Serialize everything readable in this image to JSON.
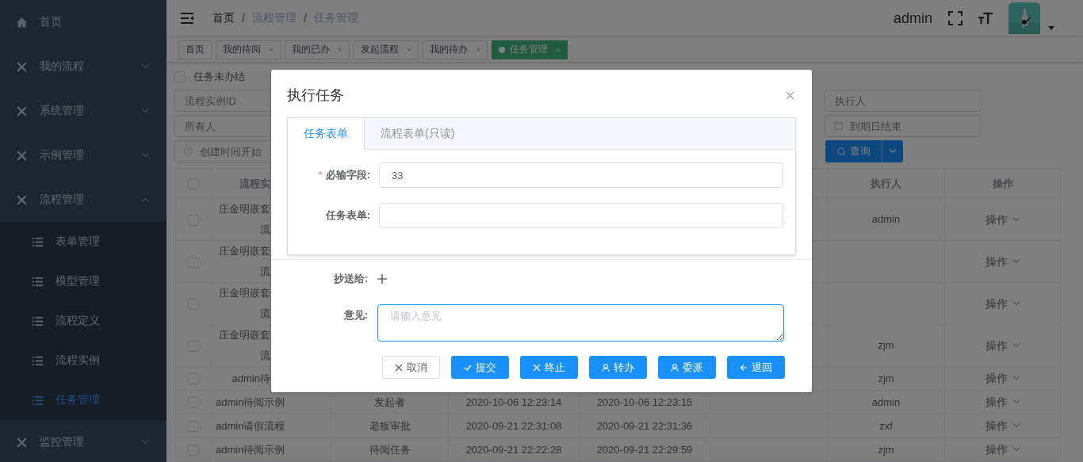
{
  "sidebar": {
    "items": [
      {
        "label": "首页",
        "kind": "link"
      },
      {
        "label": "我的流程",
        "kind": "submenu",
        "expanded": false
      },
      {
        "label": "系统管理",
        "kind": "submenu",
        "expanded": false
      },
      {
        "label": "示例管理",
        "kind": "submenu",
        "expanded": false
      },
      {
        "label": "流程管理",
        "kind": "submenu",
        "expanded": true,
        "children": [
          {
            "label": "表单管理",
            "selected": false
          },
          {
            "label": "模型管理",
            "selected": false
          },
          {
            "label": "流程定义",
            "selected": false
          },
          {
            "label": "流程实例",
            "selected": false
          },
          {
            "label": "任务管理",
            "selected": true
          }
        ]
      },
      {
        "label": "监控管理",
        "kind": "submenu",
        "expanded": false
      }
    ]
  },
  "header": {
    "breadcrumb": [
      "首页",
      "流程管理",
      "任务管理"
    ],
    "separator": "/",
    "user": "admin"
  },
  "tags": [
    {
      "label": "首页",
      "closable": false,
      "selected": false
    },
    {
      "label": "我的待阅",
      "closable": true,
      "selected": false
    },
    {
      "label": "我的已办",
      "closable": true,
      "selected": false
    },
    {
      "label": "发起流程",
      "closable": true,
      "selected": false
    },
    {
      "label": "我的待办",
      "closable": true,
      "selected": false
    },
    {
      "label": "任务管理",
      "closable": true,
      "selected": true
    }
  ],
  "filters": {
    "checkbox": {
      "label": "任务未办结",
      "checked": false
    },
    "rows": [
      [
        {
          "kind": "text",
          "placeholder": "流程实例ID"
        },
        {
          "kind": "text",
          "placeholder": "执行人"
        }
      ],
      [
        {
          "kind": "text",
          "placeholder": "所有人"
        },
        {
          "kind": "date",
          "placeholder": "到期日结束"
        }
      ],
      [
        {
          "kind": "time",
          "placeholder": "创建时间开始"
        },
        {
          "kind": "button",
          "label": "查询"
        }
      ]
    ]
  },
  "table": {
    "all_checked": false,
    "header": {
      "column_2": "流程实",
      "executor": "执行人",
      "actions": "操作"
    },
    "rows": [
      {
        "checked": false,
        "column_2": [
          "庄金明嵌套",
          "流"
        ],
        "executor": "admin",
        "actions": "操作"
      },
      {
        "checked": false,
        "column_2": [
          "庄金明嵌套",
          "流"
        ],
        "actions": "操作"
      },
      {
        "checked": false,
        "column_2": [
          "庄金明嵌套",
          "流"
        ],
        "actions": "操作"
      },
      {
        "checked": false,
        "column_2": [
          "庄金明嵌套",
          "流"
        ],
        "executor": "zjm",
        "actions": "操作"
      },
      {
        "checked": false,
        "column_2": [
          "admin待"
        ],
        "executor": "zjm",
        "actions": "操作"
      },
      {
        "checked": false,
        "column_2": [
          "admin待阅示例"
        ],
        "column_3": "发起者",
        "column_4": "2020-10-06 12:23:14",
        "column_5": "2020-10-06 12:23:15",
        "executor": "admin",
        "actions": "操作"
      },
      {
        "checked": false,
        "column_2": [
          "admin请假流程"
        ],
        "column_3": "老板审批",
        "column_4": "2020-09-21 22:31:08",
        "column_5": "2020-09-21 22:31:36",
        "executor": "zxf",
        "actions": "操作"
      },
      {
        "checked": false,
        "column_2": [
          "admin待阅示例"
        ],
        "column_3": "待阅任务",
        "column_4": "2020-09-21 22:22:28",
        "column_5": "2020-09-21 22:29:59",
        "executor": "zjm",
        "actions": "操作"
      }
    ]
  },
  "dialog": {
    "title": "执行任务",
    "tabs": [
      {
        "label": "任务表单",
        "selected": true
      },
      {
        "label": "流程表单(只读)",
        "selected": false
      }
    ],
    "fields": [
      {
        "label": "必输字段:",
        "required_mark": "*",
        "value": "33"
      },
      {
        "label": "任务表单:"
      }
    ],
    "cc": {
      "label": "抄送给:"
    },
    "comment": {
      "label": "意见:",
      "placeholder": "请输入意见",
      "focused": true
    },
    "buttons": [
      {
        "label": "取消",
        "kind": "cancel"
      },
      {
        "label": "提交",
        "kind": "submit"
      },
      {
        "label": "终止",
        "kind": "terminate"
      },
      {
        "label": "转办",
        "kind": "transfer"
      },
      {
        "label": "委派",
        "kind": "delegate"
      },
      {
        "label": "退回",
        "kind": "return"
      }
    ]
  }
}
